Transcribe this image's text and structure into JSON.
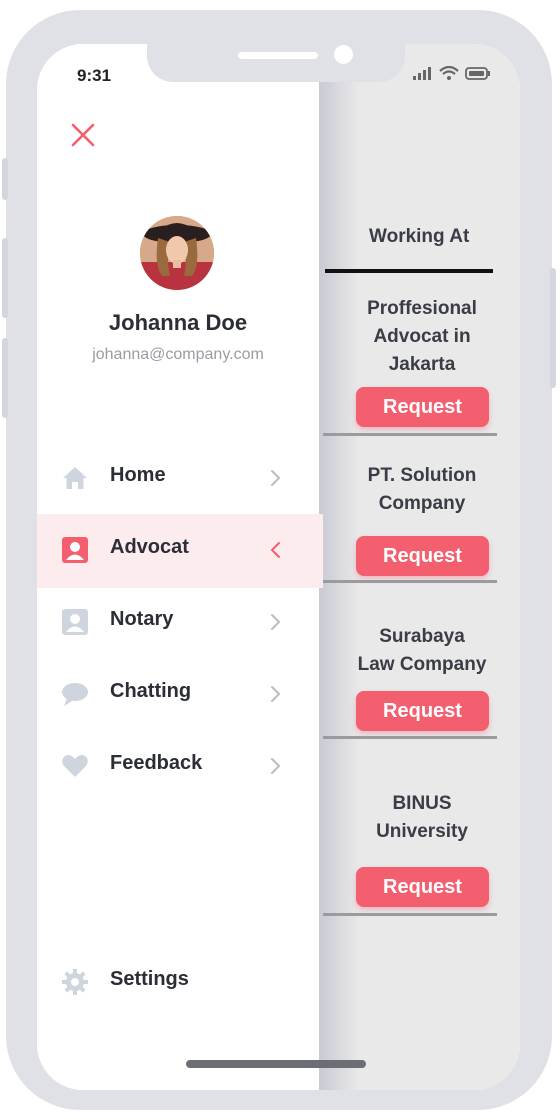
{
  "status": {
    "time": "9:31"
  },
  "user": {
    "name": "Johanna Doe",
    "email": "johanna@company.com"
  },
  "menu": [
    {
      "label": "Home",
      "icon": "home-icon",
      "active": false
    },
    {
      "label": "Advocat",
      "icon": "person-card-icon",
      "active": true
    },
    {
      "label": "Notary",
      "icon": "person-card-icon",
      "active": false
    },
    {
      "label": "Chatting",
      "icon": "chat-bubble-icon",
      "active": false
    },
    {
      "label": "Feedback",
      "icon": "heart-icon",
      "active": false
    }
  ],
  "settings": {
    "label": "Settings",
    "icon": "gear-icon"
  },
  "content": {
    "heading": "Working At",
    "companies": [
      {
        "line1": "Proffesional",
        "line2": "Advocat in",
        "line3": "Jakarta",
        "button": "Request"
      },
      {
        "line1": "PT. Solution",
        "line2": "Company",
        "button": "Request"
      },
      {
        "line1": "Surabaya",
        "line2": "Law Company",
        "button": "Request"
      },
      {
        "line1": "BINUS",
        "line2": "University",
        "button": "Request"
      }
    ]
  },
  "colors": {
    "accent": "#f35f6f",
    "active_bg": "#fdecee",
    "frame": "#dfe1e6",
    "icon_grey": "#cfd5de"
  }
}
